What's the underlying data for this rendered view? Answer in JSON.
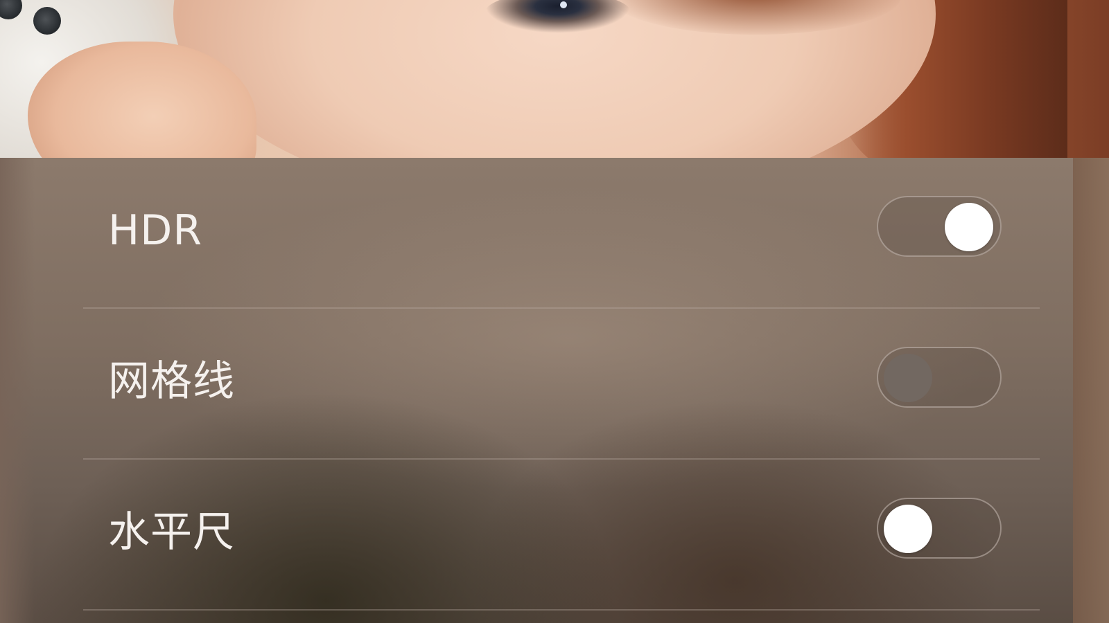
{
  "viewfinder": {
    "description_icon": "camera-preview-icon"
  },
  "settings": {
    "items": [
      {
        "label": "HDR",
        "toggle_state": "on",
        "knob_position": "right"
      },
      {
        "label": "网格线",
        "toggle_state": "off",
        "knob_position": "left"
      },
      {
        "label": "水平尺",
        "toggle_state": "on",
        "knob_position": "left"
      }
    ]
  },
  "colors": {
    "knob_on": "#ffffff",
    "knob_off": "#726861",
    "label_text": "#f5f1ee",
    "track_border": "#c8beb6"
  }
}
